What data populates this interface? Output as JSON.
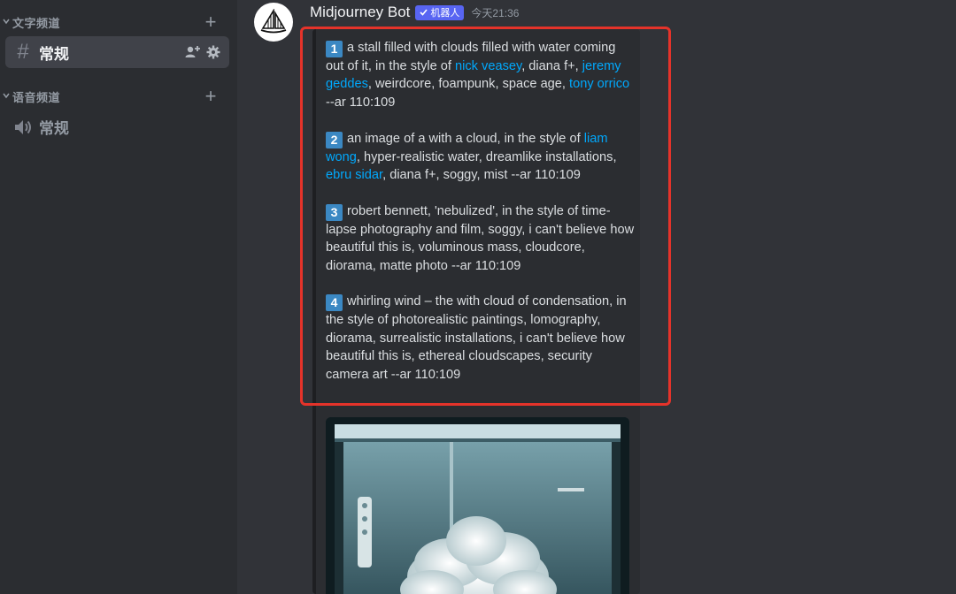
{
  "sidebar": {
    "text_category": "文字频道",
    "voice_category": "语音频道",
    "text_channel": "常规",
    "voice_channel": "常规"
  },
  "message": {
    "author": "Midjourney Bot",
    "bot_tag": "机器人",
    "timestamp": "今天21:36"
  },
  "prompts": [
    {
      "num": "1",
      "parts": [
        {
          "t": "a stall filled with clouds filled with water coming out of it, in the style of "
        },
        {
          "t": "nick veasey",
          "link": true
        },
        {
          "t": ", diana f+, "
        },
        {
          "t": "jeremy geddes",
          "link": true
        },
        {
          "t": ", weirdcore, foampunk, space age, "
        },
        {
          "t": "tony orrico",
          "link": true
        },
        {
          "t": " --ar 110:109"
        }
      ]
    },
    {
      "num": "2",
      "parts": [
        {
          "t": "an image of a with a cloud, in the style of "
        },
        {
          "t": "liam wong",
          "link": true
        },
        {
          "t": ", hyper-realistic water, dreamlike installations, "
        },
        {
          "t": "ebru sidar",
          "link": true
        },
        {
          "t": ", diana f+, soggy, mist --ar 110:109"
        }
      ]
    },
    {
      "num": "3",
      "parts": [
        {
          "t": "robert bennett, 'nebulized', in the style of time-lapse photography and film, soggy, i can't believe how beautiful this is, voluminous mass, cloudcore, diorama, matte photo --ar 110:109"
        }
      ]
    },
    {
      "num": "4",
      "parts": [
        {
          "t": "whirling wind – the with cloud of condensation, in the style of photorealistic paintings, lomography, diorama, surrealistic installations, i can't believe how beautiful this is, ethereal cloudscapes, security camera art --ar 110:109"
        }
      ]
    }
  ],
  "colors": {
    "accent_link": "#00a8fc",
    "bot_tag": "#5865f2",
    "highlight_box": "#e5332a",
    "number_badge": "#3b88c3"
  },
  "icons": [
    "hash-icon",
    "speaker-icon",
    "plus-icon",
    "add-member-icon",
    "gear-icon",
    "chevron-down-icon",
    "checkmark-icon",
    "sailboat-logo"
  ]
}
